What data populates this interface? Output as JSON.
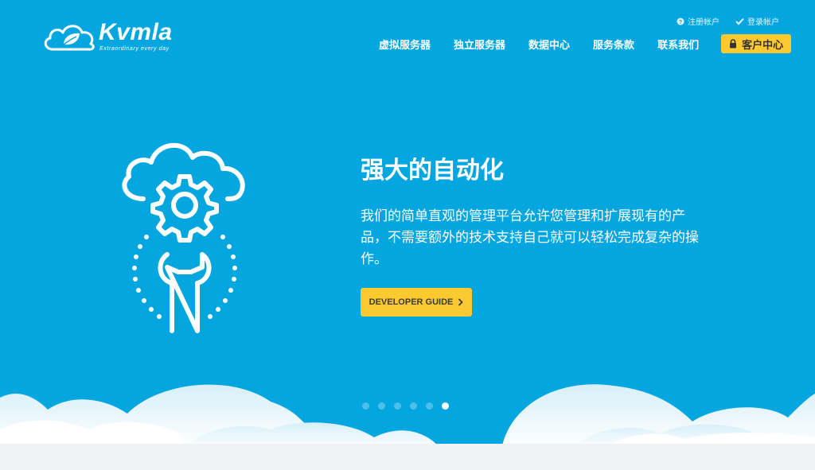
{
  "brand": {
    "name": "Kvmla",
    "tagline": "Extraordinary every day"
  },
  "top_links": [
    {
      "label": "注册帐户",
      "icon": "help-circle-icon"
    },
    {
      "label": "登录帐户",
      "icon": "check-icon"
    }
  ],
  "nav": {
    "items": [
      {
        "label": "虚拟服务器"
      },
      {
        "label": "独立服务器"
      },
      {
        "label": "数据中心"
      },
      {
        "label": "服务条款"
      },
      {
        "label": "联系我们"
      }
    ],
    "client_button": {
      "label": "客户中心",
      "icon": "lock-icon"
    }
  },
  "hero": {
    "headline": "强大的自动化",
    "description": "我们的简单直观的管理平台允许您管理和扩展现有的产品，不需要额外的技术支持自己就可以轻松完成复杂的操作。",
    "cta_label": "DEVELOPER GUIDE",
    "illustration_icon": "cloud-gear-wrench-icon"
  },
  "slider": {
    "count": 6,
    "active_index": 5
  },
  "colors": {
    "hero_bg": "#03a6df",
    "accent": "#fdc930",
    "page_bg": "#f1f2f4"
  }
}
